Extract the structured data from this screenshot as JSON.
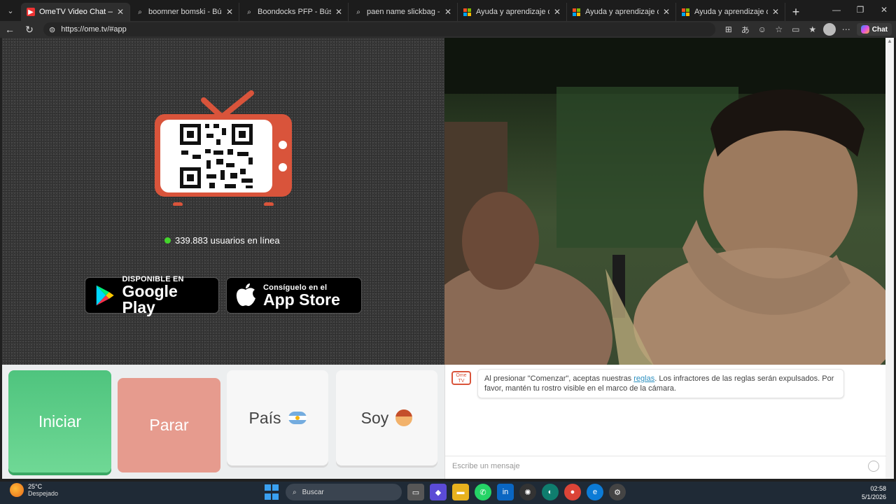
{
  "browser": {
    "tabs": [
      {
        "title": "OmeTV Video Chat — ",
        "favicon": "youtube-style-icon",
        "active": true
      },
      {
        "title": "boomner bomski - Búsqueda",
        "favicon": "search-icon",
        "active": false
      },
      {
        "title": "Boondocks PFP - Búsqueda",
        "favicon": "search-icon",
        "active": false
      },
      {
        "title": "paen name slickbag - Búsq",
        "favicon": "search-icon",
        "active": false
      },
      {
        "title": "Ayuda y aprendizaje de Mic",
        "favicon": "microsoft-icon",
        "active": false
      },
      {
        "title": "Ayuda y aprendizaje de Mic",
        "favicon": "microsoft-icon",
        "active": false
      },
      {
        "title": "Ayuda y aprendizaje de Mic",
        "favicon": "microsoft-icon",
        "active": false
      }
    ],
    "url": "https://ome.tv/#app",
    "copilot_label": "Chat"
  },
  "app": {
    "online_count_text": "339.883 usuarios en línea",
    "google_play": {
      "small": "DISPONIBLE EN",
      "big": "Google Play"
    },
    "app_store": {
      "small": "Consíguelo en el",
      "big": "App Store"
    },
    "buttons": {
      "start": "Iniciar",
      "stop": "Parar",
      "country": "País",
      "gender": "Soy"
    },
    "chat": {
      "logo_text": "Ome TV",
      "message_before": "Al presionar \"Comenzar\", aceptas nuestras ",
      "message_link": "reglas",
      "message_after": ". Los infractores de las reglas serán expulsados. Por favor, mantén tu rostro visible en el marco de la cámara.",
      "input_placeholder": "Escribe un mensaje"
    }
  },
  "taskbar": {
    "weather_temp": "25°C",
    "weather_desc": "Despejado",
    "search_label": "Buscar",
    "time": "02:58",
    "date": "5/1/2026"
  },
  "colors": {
    "start_green": "#4fc47e",
    "stop_red": "#e69b8e",
    "tv_orange": "#d9543b",
    "online_green": "#44d62c"
  }
}
